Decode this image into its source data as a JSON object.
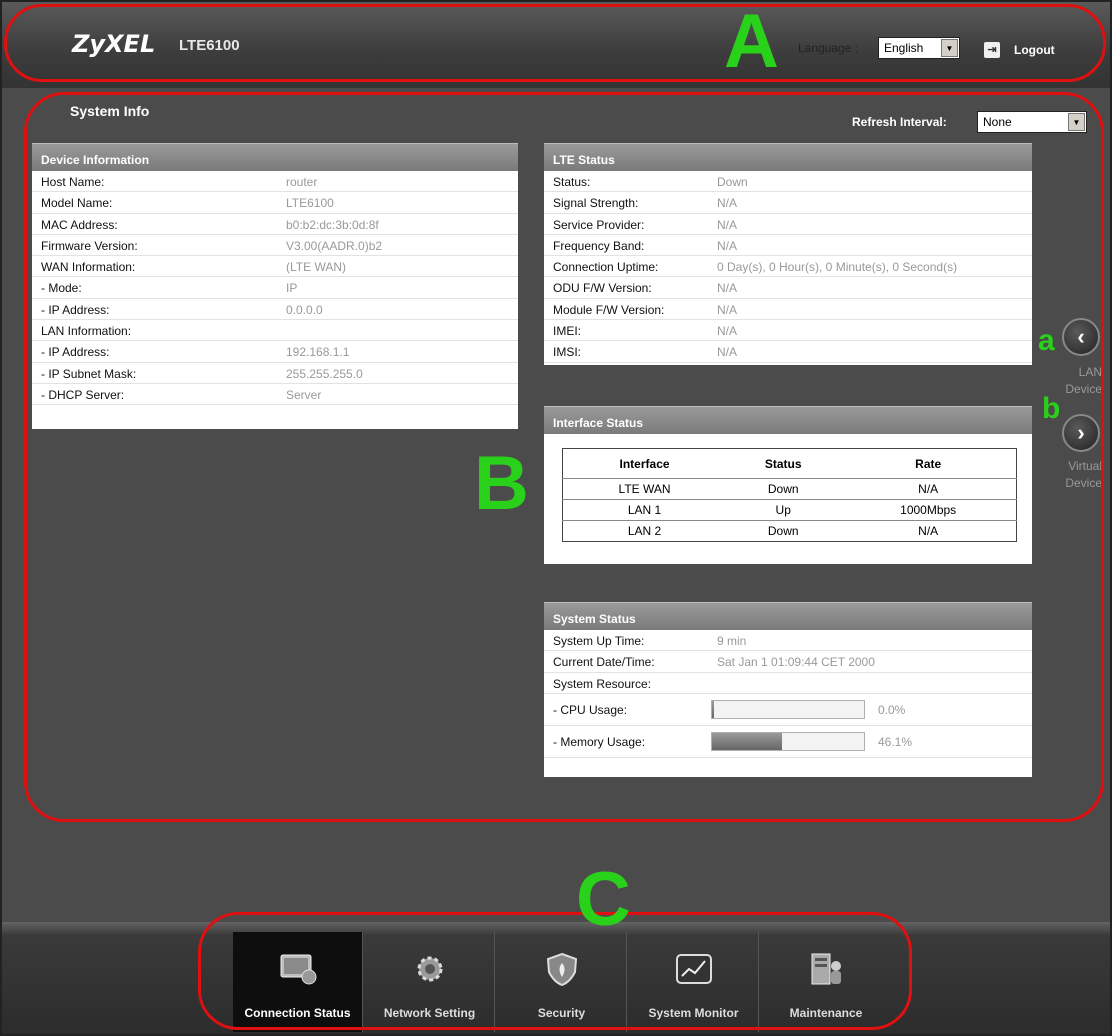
{
  "header": {
    "logo": "ZyXEL",
    "model": "LTE6100",
    "language_label": "Language :",
    "language_value": "English",
    "logout_label": "Logout"
  },
  "page": {
    "title": "System Info",
    "refresh_label": "Refresh Interval:",
    "refresh_value": "None"
  },
  "device_info": {
    "title": "Device Information",
    "rows": [
      {
        "label": "Host Name:",
        "value": "router"
      },
      {
        "label": "Model Name:",
        "value": "LTE6100"
      },
      {
        "label": "MAC Address:",
        "value": "b0:b2:dc:3b:0d:8f"
      },
      {
        "label": "Firmware Version:",
        "value": "V3.00(AADR.0)b2"
      },
      {
        "label": "WAN Information:",
        "value": " (LTE WAN)"
      },
      {
        "label": " - Mode:",
        "value": "IP"
      },
      {
        "label": " - IP Address:",
        "value": "0.0.0.0"
      },
      {
        "label": "LAN Information:",
        "value": ""
      },
      {
        "label": " - IP Address:",
        "value": "192.168.1.1"
      },
      {
        "label": " - IP Subnet Mask:",
        "value": "255.255.255.0"
      },
      {
        "label": " - DHCP Server:",
        "value": "Server"
      }
    ]
  },
  "lte_status": {
    "title": "LTE Status",
    "rows": [
      {
        "label": "Status:",
        "value": "Down"
      },
      {
        "label": "Signal Strength:",
        "value": "N/A"
      },
      {
        "label": "Service Provider:",
        "value": "N/A"
      },
      {
        "label": "Frequency Band:",
        "value": "N/A"
      },
      {
        "label": "Connection Uptime:",
        "value": "0 Day(s), 0 Hour(s), 0 Minute(s), 0 Second(s)"
      },
      {
        "label": "ODU F/W Version:",
        "value": "N/A"
      },
      {
        "label": "Module F/W Version:",
        "value": "N/A"
      },
      {
        "label": "IMEI:",
        "value": "N/A"
      },
      {
        "label": "IMSI:",
        "value": "N/A"
      }
    ]
  },
  "interface_status": {
    "title": "Interface Status",
    "headers": [
      "Interface",
      "Status",
      "Rate"
    ],
    "rows": [
      [
        "LTE WAN",
        "Down",
        "N/A"
      ],
      [
        "LAN 1",
        "Up",
        "1000Mbps"
      ],
      [
        "LAN 2",
        "Down",
        "N/A"
      ]
    ]
  },
  "system_status": {
    "title": "System Status",
    "rows": [
      {
        "label": "System Up Time:",
        "value": "9 min"
      },
      {
        "label": "Current Date/Time:",
        "value": "Sat Jan 1 01:09:44 CET 2000"
      },
      {
        "label": "System Resource:",
        "value": ""
      }
    ],
    "cpu_label": " - CPU Usage:",
    "cpu_value": "0.0%",
    "cpu_fraction": 0.0,
    "mem_label": " - Memory Usage:",
    "mem_value": "46.1%",
    "mem_fraction": 0.461
  },
  "side_nav": {
    "lan_label_1": "LAN",
    "lan_label_2": "Device",
    "virtual_label_1": "Virtual",
    "virtual_label_2": "Device"
  },
  "bottom_nav": [
    {
      "label": "Connection Status",
      "icon": "monitor-icon",
      "active": true
    },
    {
      "label": "Network Setting",
      "icon": "gear-icon",
      "active": false
    },
    {
      "label": "Security",
      "icon": "shield-icon",
      "active": false
    },
    {
      "label": "System Monitor",
      "icon": "chart-icon",
      "active": false
    },
    {
      "label": "Maintenance",
      "icon": "maintenance-icon",
      "active": false
    }
  ],
  "annotations": {
    "A": "A",
    "B": "B",
    "C": "C",
    "a": "a",
    "b": "b"
  },
  "colors": {
    "callout": "#e01010",
    "letter": "#2ad11a",
    "panel_header": "#8a8a8a",
    "background": "#4b4b4b"
  }
}
